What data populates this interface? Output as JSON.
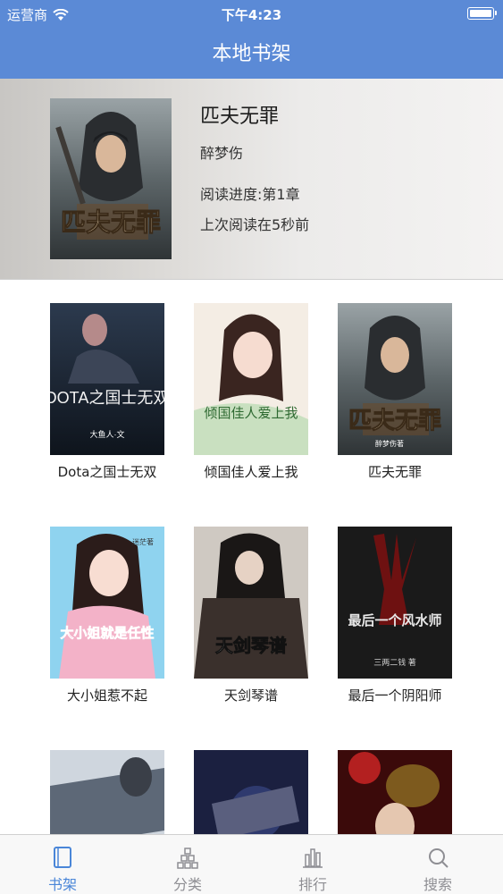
{
  "status_bar": {
    "carrier": "运营商",
    "time": "下午4:23"
  },
  "nav": {
    "title": "本地书架"
  },
  "featured": {
    "title": "匹夫无罪",
    "author": "醉梦伤",
    "progress": "阅读进度:第1章",
    "last_read": "上次阅读在5秒前",
    "cover_text": "匹夫无罪"
  },
  "books": [
    {
      "title": "Dota之国士无双",
      "cover_text": "DOTA之国士无双",
      "cover_sub": "大鱼人·文"
    },
    {
      "title": "倾国佳人爱上我",
      "cover_text": "倾国佳人爱上我",
      "cover_sub": ""
    },
    {
      "title": "匹夫无罪",
      "cover_text": "匹夫无罪",
      "cover_sub": "醉梦伤著"
    },
    {
      "title": "大小姐惹不起",
      "cover_text": "大小姐就是任性",
      "cover_sub": "迷茫著"
    },
    {
      "title": "天剑琴谱",
      "cover_text": "天剑琴谱",
      "cover_sub": ""
    },
    {
      "title": "最后一个阴阳师",
      "cover_text": "最后一个风水师",
      "cover_sub": "三两二钱 著"
    }
  ],
  "tabs": [
    {
      "label": "书架",
      "icon": "bookshelf-icon",
      "active": true
    },
    {
      "label": "分类",
      "icon": "category-icon",
      "active": false
    },
    {
      "label": "排行",
      "icon": "ranking-icon",
      "active": false
    },
    {
      "label": "搜索",
      "icon": "search-icon",
      "active": false
    }
  ],
  "colors": {
    "nav_bg": "#5b8ad6",
    "tab_active": "#4a86d8",
    "tab_inactive": "#8e8e93"
  }
}
